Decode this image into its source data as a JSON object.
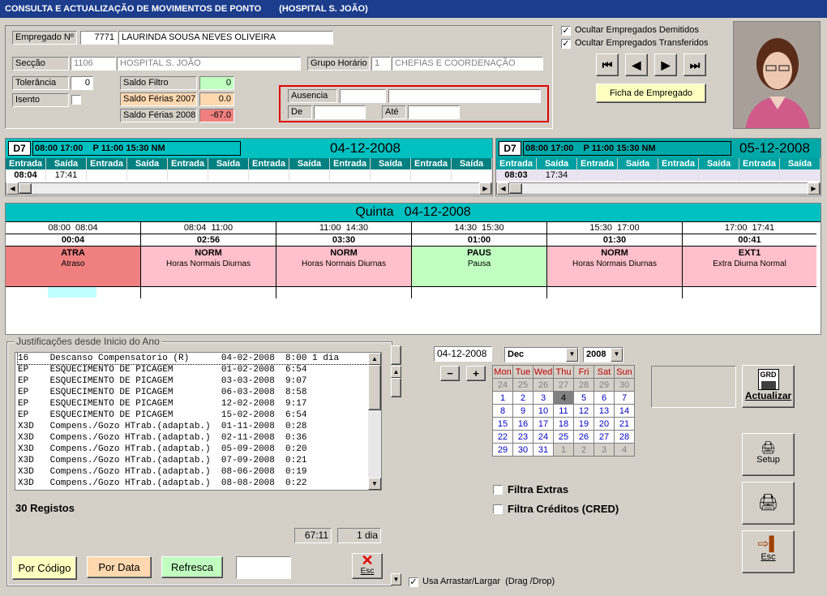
{
  "title": {
    "main": "CONSULTA E ACTUALIZAÇÃO DE MOVIMENTOS DE PONTO",
    "sub": "(HOSPITAL S. JOÃO)"
  },
  "employee": {
    "label": "Empregado Nº",
    "number": "7771",
    "name": "LAURINDA SOUSA NEVES OLIVEIRA",
    "section_label": "Secção",
    "section_code": "1106",
    "section_name": "HOSPITAL S. JOÃO",
    "group_label": "Grupo Horário",
    "group_code": "1",
    "group_name": "CHEFIAS E COORDENAÇÃO",
    "tolerance_label": "Tolerância",
    "tolerance": "0",
    "exempt_label": "Isento",
    "saldo_filtro_label": "Saldo Filtro",
    "saldo_filtro": "0",
    "saldo_2007_label": "Saldo Férias 2007",
    "saldo_2007": "0.0",
    "saldo_2008_label": "Saldo Férias 2008",
    "saldo_2008": "-67.0"
  },
  "absence": {
    "label": "Ausencia",
    "from_label": "De",
    "to_label": "Até"
  },
  "options": {
    "hide_dismissed": "Ocultar Empregados Demitidos",
    "hide_transferred": "Ocultar Empregados Transferidos",
    "record_button": "Ficha de Empregado"
  },
  "nav": {
    "first": "⏮",
    "prev": "◀",
    "next": "▶",
    "last": "⏭"
  },
  "days": [
    {
      "code": "D7",
      "schedule": "08:00 17:00    P 11:00 15:30 NM",
      "date": "04-12-2008",
      "cols": [
        "Entrada",
        "Saída",
        "Entrada",
        "Saída",
        "Entrada",
        "Saída",
        "Entrada",
        "Saída",
        "Entrada",
        "Saída",
        "Entrada",
        "Saída"
      ],
      "values": [
        "08:04",
        "17:41",
        "",
        "",
        "",
        "",
        "",
        "",
        "",
        "",
        "",
        ""
      ]
    },
    {
      "code": "D7",
      "schedule": "08:00 17:00    P 11:00 15:30 NM",
      "date": "05-12-2008",
      "cols": [
        "Entrada",
        "Saída",
        "Entrada",
        "Saída",
        "Entrada",
        "Saída",
        "Entrada",
        "Saída"
      ],
      "values": [
        "08:03",
        "17:34",
        "",
        "",
        "",
        "",
        "",
        ""
      ]
    }
  ],
  "detail": {
    "title": "Quinta   04-12-2008",
    "segments": [
      {
        "time": "08:00  08:04",
        "dur": "00:04",
        "code": "ATRA",
        "desc": "Atraso",
        "color": "#f08080"
      },
      {
        "time": "08:04  11:00",
        "dur": "02:56",
        "code": "NORM",
        "desc": "Horas Normais Diurnas",
        "color": "#ffc0cb"
      },
      {
        "time": "11:00  14:30",
        "dur": "03:30",
        "code": "NORM",
        "desc": "Horas Normais Diurnas",
        "color": "#ffc0cb"
      },
      {
        "time": "14:30  15:30",
        "dur": "01:00",
        "code": "PAUS",
        "desc": "Pausa",
        "color": "#c0ffc0"
      },
      {
        "time": "15:30  17:00",
        "dur": "01:30",
        "code": "NORM",
        "desc": "Horas Normais Diurnas",
        "color": "#ffc0cb"
      },
      {
        "time": "17:00  17:41",
        "dur": "00:41",
        "code": "EXT1",
        "desc": "Extra Diurna Normal",
        "color": "#ffc0cb"
      }
    ]
  },
  "justifications": {
    "legend": "Justificações desde Inicio do Ano",
    "rows": [
      "16    Descanso Compensatorio (R)      04-02-2008  8:00 1 dia",
      "EP    ESQUECIMENTO DE PICAGEM         01-02-2008  6:54",
      "EP    ESQUECIMENTO DE PICAGEM         03-03-2008  9:07",
      "EP    ESQUECIMENTO DE PICAGEM         06-03-2008  8:58",
      "EP    ESQUECIMENTO DE PICAGEM         12-02-2008  9:17",
      "EP    ESQUECIMENTO DE PICAGEM         15-02-2008  6:54",
      "X3D   Compens./Gozo HTrab.(adaptab.)  01-11-2008  0:28",
      "X3D   Compens./Gozo HTrab.(adaptab.)  02-11-2008  0:36",
      "X3D   Compens./Gozo HTrab.(adaptab.)  05-09-2008  0:20",
      "X3D   Compens./Gozo HTrab.(adaptab.)  07-09-2008  0:21",
      "X3D   Compens./Gozo HTrab.(adaptab.)  08-06-2008  0:19",
      "X3D   Compens./Gozo HTrab.(adaptab.)  08-08-2008  0:22"
    ],
    "count": "30 Registos",
    "total_hours": "67:11",
    "total_days": "1 dia",
    "by_code": "Por Código",
    "by_date": "Por Data",
    "refresh": "Refresca",
    "esc": "Esc"
  },
  "calendar": {
    "date": "04-12-2008",
    "month": "Dec",
    "year": "2008",
    "minus": "−",
    "plus": "+",
    "weekdays": [
      "Mon",
      "Tue",
      "Wed",
      "Thu",
      "Fri",
      "Sat",
      "Sun"
    ],
    "weeks": [
      [
        "24",
        "25",
        "26",
        "27",
        "28",
        "29",
        "30"
      ],
      [
        "1",
        "2",
        "3",
        "4",
        "5",
        "6",
        "7"
      ],
      [
        "8",
        "9",
        "10",
        "11",
        "12",
        "13",
        "14"
      ],
      [
        "15",
        "16",
        "17",
        "18",
        "19",
        "20",
        "21"
      ],
      [
        "22",
        "23",
        "24",
        "25",
        "26",
        "27",
        "28"
      ],
      [
        "29",
        "30",
        "31",
        "1",
        "2",
        "3",
        "4"
      ]
    ]
  },
  "side": {
    "update": "Actualizar",
    "setup": "Setup",
    "esc": "Esc",
    "grd": "GRD"
  },
  "filters": {
    "extras": "Filtra Extras",
    "credits": "Filtra Créditos (CRED)",
    "drag": "Usa Arrastar/Largar  (Drag /Drop)"
  }
}
